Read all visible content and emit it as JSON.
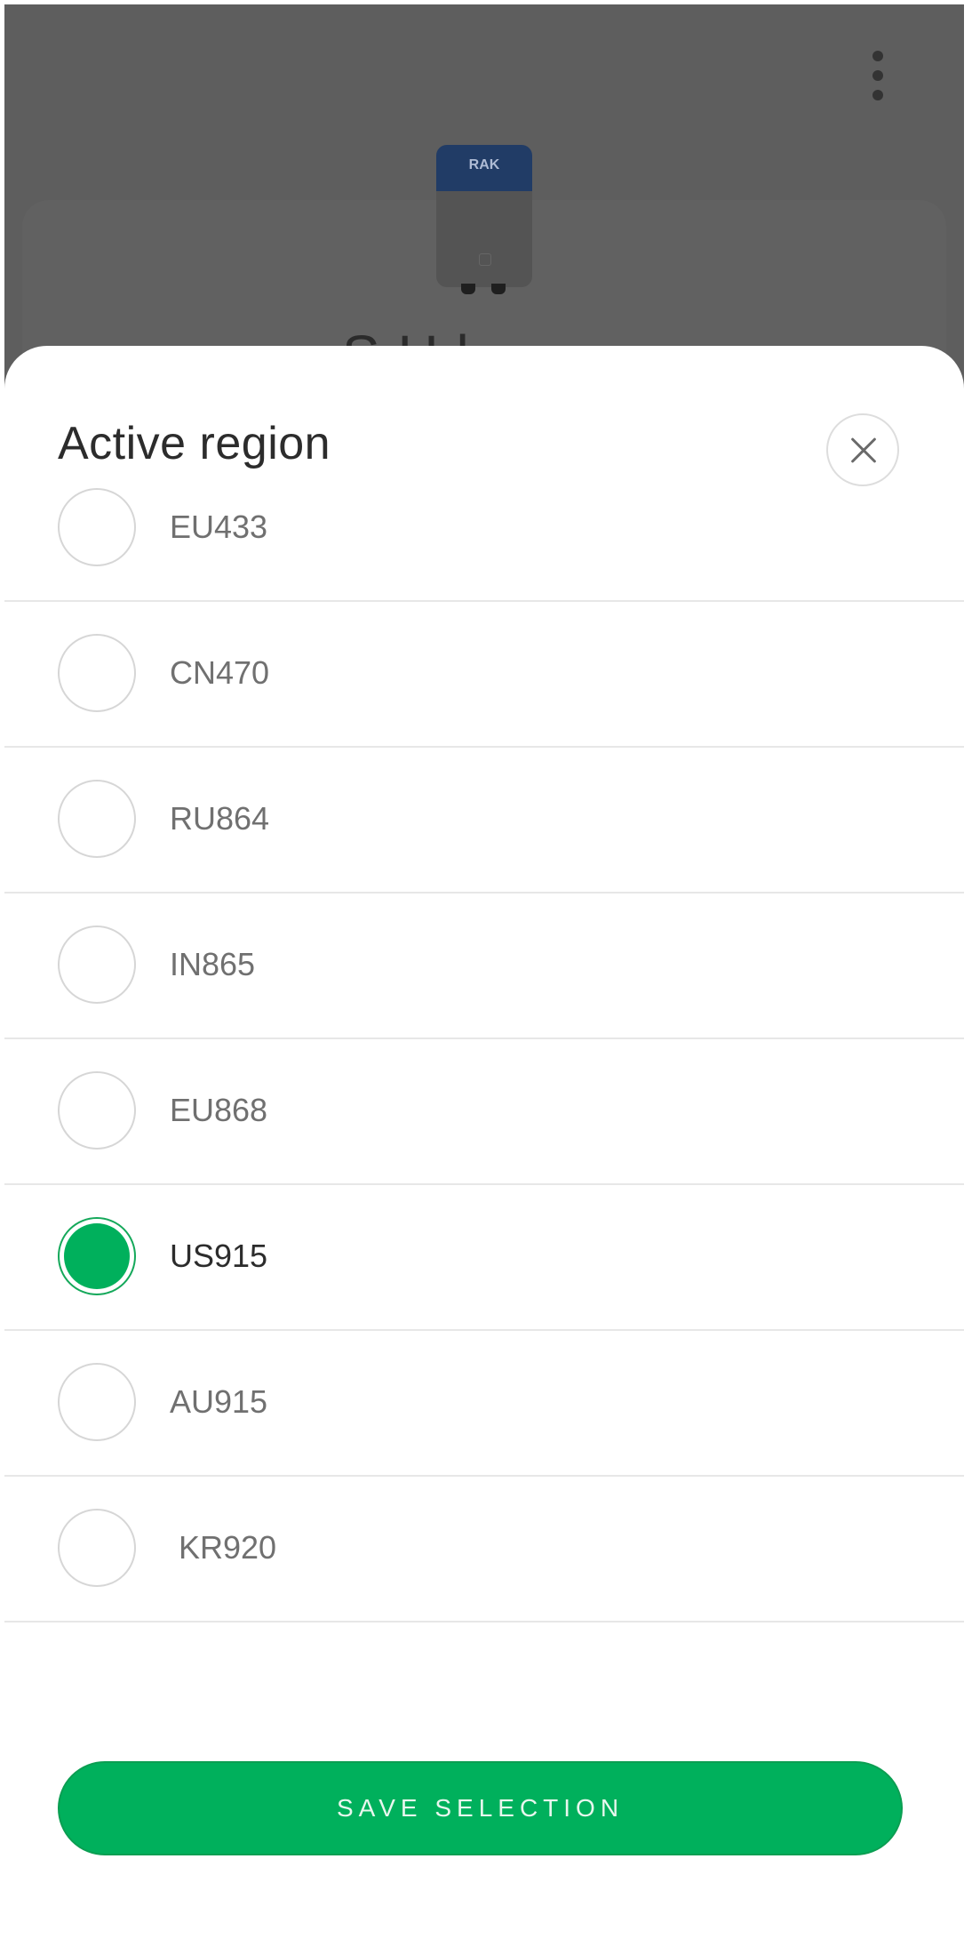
{
  "background": {
    "device_brand": "RAK",
    "title_partial": "S    H l"
  },
  "sheet": {
    "title": "Active region",
    "close_icon": "close-icon",
    "regions": [
      {
        "label": "EU433",
        "selected": false
      },
      {
        "label": "CN470",
        "selected": false
      },
      {
        "label": "RU864",
        "selected": false
      },
      {
        "label": "IN865",
        "selected": false
      },
      {
        "label": "EU868",
        "selected": false
      },
      {
        "label": "US915",
        "selected": true
      },
      {
        "label": "AU915",
        "selected": false
      },
      {
        "label": "KR920",
        "selected": false
      }
    ],
    "save_label": "SAVE SELECTION"
  },
  "colors": {
    "accent": "#00b05c",
    "overlay": "#5e5e5e"
  }
}
